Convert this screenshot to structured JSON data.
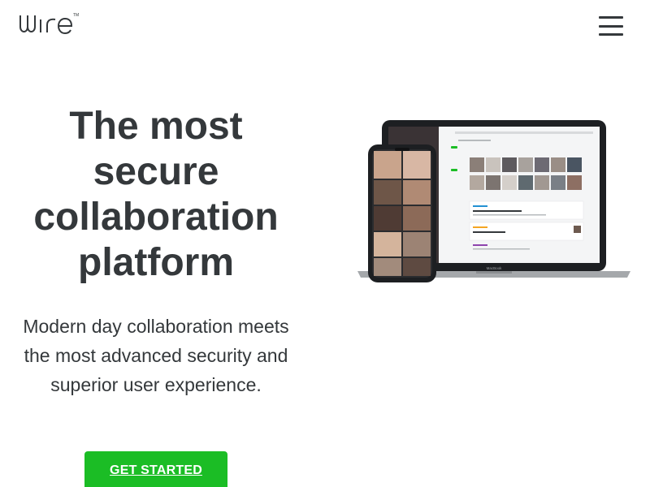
{
  "header": {
    "logo_text": "wire",
    "logo_icon": "wire-logo",
    "menu_icon": "hamburger-menu-icon"
  },
  "hero": {
    "title_lines": [
      "The most",
      "secure",
      "collaboration",
      "platform"
    ],
    "subtitle_lines": [
      "Modern day collaboration meets",
      "the most advanced security and",
      "superior user experience."
    ],
    "cta_label": "GET STARTED"
  },
  "illustration": {
    "laptop_label": "MacBook",
    "icon": "devices-illustration",
    "accent_color": "#1bbd25"
  },
  "colors": {
    "text": "#34383b",
    "cta_background": "#1bbd25",
    "cta_text": "#ffffff"
  }
}
